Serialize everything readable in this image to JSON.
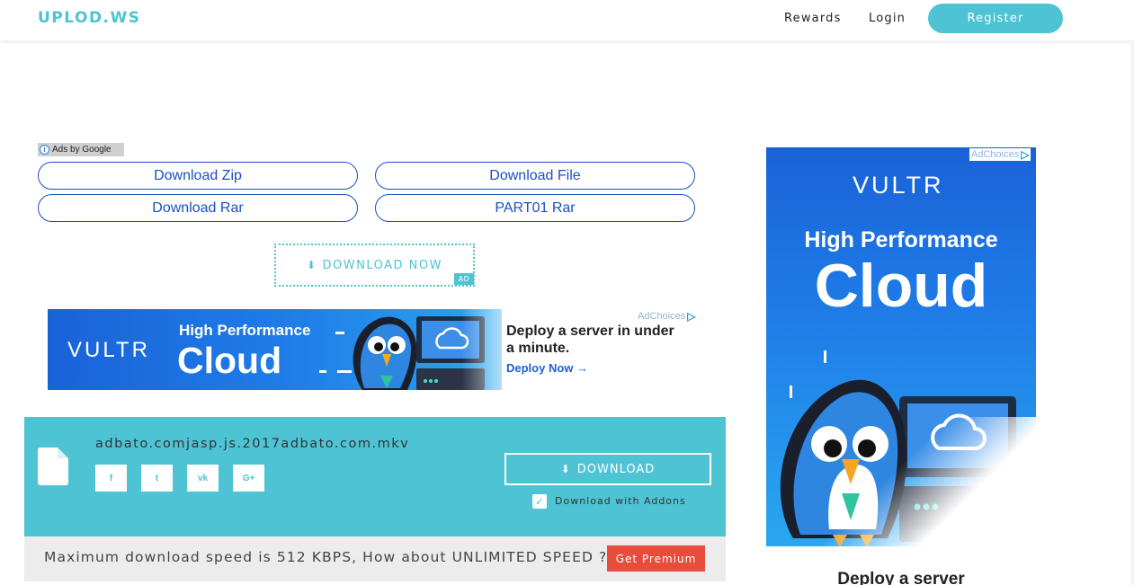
{
  "header": {
    "logo": "UPLOD.WS",
    "nav": {
      "rewards": "Rewards",
      "login": "Login",
      "register": "Register"
    }
  },
  "ads_by_google": "Ads by Google",
  "link_buttons": {
    "zip": "Download Zip",
    "file": "Download File",
    "rar": "Download Rar",
    "part": "PART01 Rar"
  },
  "download_now": {
    "label": "DOWNLOAD NOW",
    "tag": "AD"
  },
  "banner_ad": {
    "adchoices": "AdChoices",
    "brand": "VULTR",
    "headline_small": "High Performance",
    "headline_big": "Cloud",
    "deploy_text": "Deploy a server in under a minute.",
    "cta": "Deploy Now →"
  },
  "file_panel": {
    "file_name": "adbato.comjasp.js.2017adbato.com.mkv",
    "social": {
      "facebook": "f",
      "twitter": "t",
      "vk": "vk",
      "google_plus": "G+"
    },
    "download_button": "DOWNLOAD",
    "addons_label": "Download with Addons",
    "addons_checked": true
  },
  "premium": {
    "text": "Maximum download speed is 512 KBPS, How about UNLIMITED SPEED ?",
    "button": "Get Premium"
  },
  "side_ad": {
    "adchoices": "AdChoices",
    "brand": "VULTR",
    "headline_small": "High Performance",
    "headline_big": "Cloud",
    "deploy_text": "Deploy a server"
  },
  "colors": {
    "accent": "#4ec3d3",
    "link_blue": "#1c4ec2",
    "ad_blue": "#1a62d8",
    "premium_red": "#e74c3c"
  }
}
